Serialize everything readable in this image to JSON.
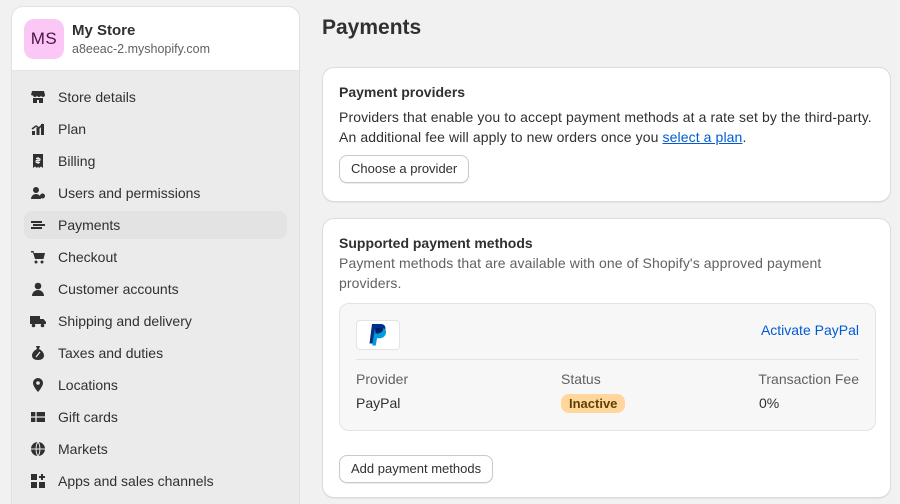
{
  "store": {
    "initials": "MS",
    "name": "My Store",
    "url": "a8eeac-2.myshopify.com"
  },
  "nav": [
    {
      "label": "Store details",
      "icon": "store-icon"
    },
    {
      "label": "Plan",
      "icon": "plan-icon"
    },
    {
      "label": "Billing",
      "icon": "billing-icon"
    },
    {
      "label": "Users and permissions",
      "icon": "users-icon"
    },
    {
      "label": "Payments",
      "icon": "payments-icon",
      "active": true
    },
    {
      "label": "Checkout",
      "icon": "cart-icon"
    },
    {
      "label": "Customer accounts",
      "icon": "person-icon"
    },
    {
      "label": "Shipping and delivery",
      "icon": "truck-icon"
    },
    {
      "label": "Taxes and duties",
      "icon": "tax-icon"
    },
    {
      "label": "Locations",
      "icon": "location-icon"
    },
    {
      "label": "Gift cards",
      "icon": "gift-card-icon"
    },
    {
      "label": "Markets",
      "icon": "globe-icon"
    },
    {
      "label": "Apps and sales channels",
      "icon": "apps-icon"
    }
  ],
  "page": {
    "title": "Payments"
  },
  "providers": {
    "title": "Payment providers",
    "description_before": "Providers that enable you to accept payment methods at a rate set by the third-party. An additional fee will apply to new orders once you ",
    "link": "select a plan",
    "description_after": ".",
    "button": "Choose a provider"
  },
  "methods": {
    "title": "Supported payment methods",
    "description": "Payment methods that are available with one of Shopify's approved payment providers.",
    "activate_link": "Activate PayPal",
    "headers": {
      "provider": "Provider",
      "status": "Status",
      "fee": "Transaction Fee"
    },
    "row": {
      "provider": "PayPal",
      "status": "Inactive",
      "fee": "0%"
    },
    "button": "Add payment methods"
  },
  "colors": {
    "accent_link": "#005bd3",
    "badge_bg": "#ffd79d",
    "avatar_bg": "#fbc8f5"
  }
}
